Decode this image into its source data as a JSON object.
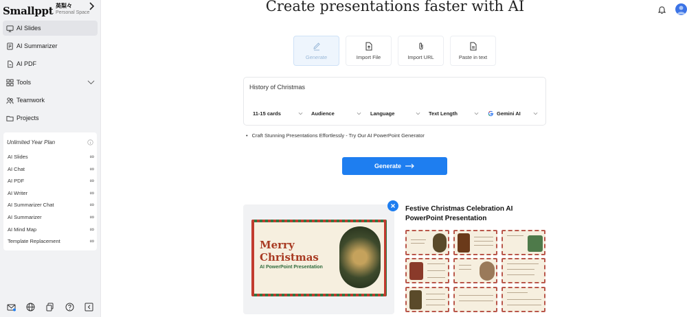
{
  "brand": {
    "logo": "Smallppt",
    "user_name": "英梨々",
    "space": "Personal Space"
  },
  "nav": [
    {
      "label": "AI Slides",
      "active": true
    },
    {
      "label": "AI Summarizer"
    },
    {
      "label": "AI PDF"
    },
    {
      "label": "Tools",
      "expandable": true
    },
    {
      "label": "Teamwork"
    },
    {
      "label": "Projects"
    }
  ],
  "plan": {
    "title": "Unlimited Year Plan",
    "items": [
      {
        "label": "AI Slides",
        "value": "∞"
      },
      {
        "label": "AI Chat",
        "value": "∞"
      },
      {
        "label": "AI PDF",
        "value": "∞"
      },
      {
        "label": "AI Writer",
        "value": "∞"
      },
      {
        "label": "AI Summarizer Chat",
        "value": "∞"
      },
      {
        "label": "AI Summarizer",
        "value": "∞"
      },
      {
        "label": "AI Mind Map",
        "value": "∞"
      },
      {
        "label": "Template Replacement",
        "value": "∞"
      }
    ]
  },
  "main": {
    "title": "Create presentations faster with AI",
    "modes": [
      {
        "label": "Generate",
        "active": true
      },
      {
        "label": "Import File"
      },
      {
        "label": "Import URL"
      },
      {
        "label": "Paste in text"
      }
    ],
    "prompt": "History of Christmas",
    "options": [
      {
        "label": "11-15 cards"
      },
      {
        "label": "Audience"
      },
      {
        "label": "Language"
      },
      {
        "label": "Text Length"
      },
      {
        "label": "Gemini AI"
      }
    ],
    "hint": "Craft Stunning Presentations Effortlessly - Try Our AI PowerPoint Generator",
    "generate_label": "Generate"
  },
  "preview": {
    "slide_title_1": "Merry",
    "slide_title_2": "Christmas",
    "slide_subtitle": "AI PowerPoint Presentation",
    "template_title": "Festive Christmas Celebration AI PowerPoint Presentation"
  },
  "colors": {
    "accent": "#1e7ef0",
    "sidebar_bg": "#f1f2f4",
    "slide_red": "#a83a22",
    "slide_green": "#2f6b3c"
  }
}
